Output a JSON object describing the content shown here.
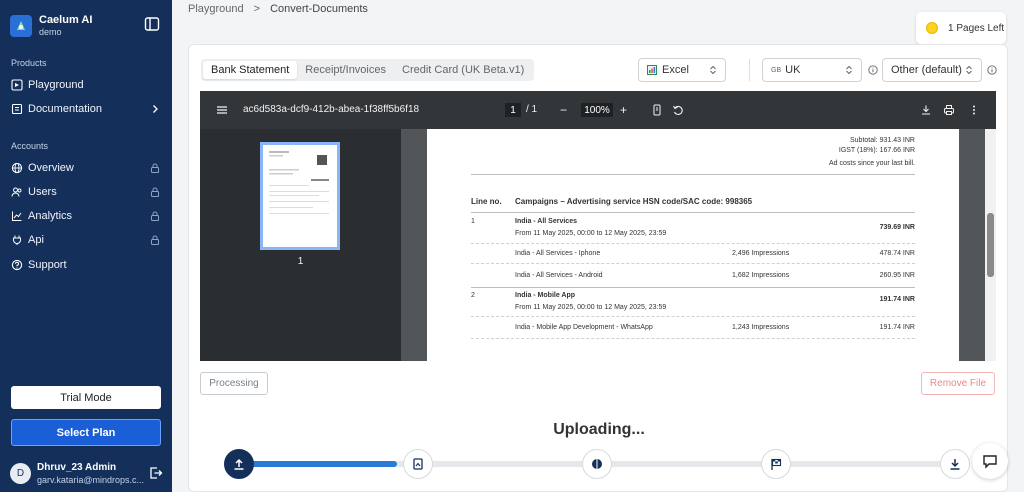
{
  "sidebar": {
    "brand_name": "Caelum AI",
    "brand_sub": "demo",
    "sections": {
      "products": "Products",
      "accounts": "Accounts"
    },
    "items": [
      {
        "label": "Playground",
        "icon": "playground-icon"
      },
      {
        "label": "Documentation",
        "icon": "book-icon"
      },
      {
        "label": "Overview",
        "icon": "globe-icon",
        "locked": true
      },
      {
        "label": "Users",
        "icon": "users-icon",
        "locked": true
      },
      {
        "label": "Analytics",
        "icon": "chart-icon",
        "locked": true
      },
      {
        "label": "Api",
        "icon": "plug-icon",
        "locked": true
      },
      {
        "label": "Support",
        "icon": "support-icon"
      }
    ],
    "trial_label": "Trial Mode",
    "plan_label": "Select Plan",
    "user": {
      "initial": "D",
      "name": "Dhruv_23 Admin",
      "email": "garv.kataria@mindrops.c..."
    }
  },
  "header": {
    "breadcrumb": [
      "Playground",
      "Convert-Documents"
    ],
    "breadcrumb_sep": ">",
    "pages_left": "1 Pages Left"
  },
  "toolbar": {
    "tabs": [
      "Bank Statement",
      "Receipt/Invoices",
      "Credit Card (UK Beta.v1)"
    ],
    "active_tab": 0,
    "format": "Excel",
    "region_code": "GB",
    "region": "UK",
    "profile": "Other (default)"
  },
  "viewer": {
    "doc_id": "ac6d583a-dcf9-412b-abea-1f38ff5b6f18",
    "page_current": "1",
    "page_total": "/  1",
    "zoom_minus": "−",
    "zoom": "100%",
    "zoom_plus": "+",
    "thumb_number": "1",
    "doc": {
      "subtotal": "Subtotal: 931.43 INR",
      "igst": "IGST (18%): 167.66 INR",
      "ad_costs": "Ad costs since your last bill.",
      "col_line": "Line no.",
      "col_campaign": "Campaigns – Advertising service HSN code/SAC code: 998365",
      "rows": [
        {
          "line": "1",
          "title": "India - All Services",
          "period": "From 11 May 2025, 00:00 to 12 May 2025, 23:59",
          "amount": "739.69 INR"
        },
        {
          "title": "India - All Services - Iphone",
          "impressions": "2,496 Impressions",
          "amount": "478.74 INR"
        },
        {
          "title": "India - All Services - Android",
          "impressions": "1,682 Impressions",
          "amount": "260.95 INR"
        },
        {
          "line": "2",
          "title": "India - Mobile App",
          "period": "From 11 May 2025, 00:00 to 12 May 2025, 23:59",
          "amount": "191.74 INR"
        },
        {
          "title": "India - Mobile App Development - WhatsApp",
          "impressions": "1,243 Impressions",
          "amount": "191.74 INR"
        }
      ]
    }
  },
  "actions": {
    "processing": "Processing",
    "remove": "Remove File"
  },
  "progress": {
    "label": "Uploading...",
    "fraction": 0.22
  }
}
